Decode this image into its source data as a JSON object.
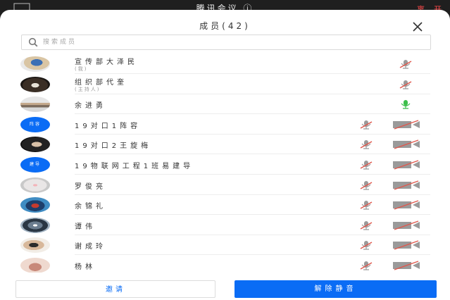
{
  "topbar": {
    "title": "腾讯会议 ⓘ",
    "leave": "离",
    "end": "开"
  },
  "panel": {
    "title": "成员(42)",
    "search_placeholder": "搜索成员"
  },
  "colors": {
    "accent": "#0a6cf5",
    "muted_red": "#e0574c",
    "mic_on_green": "#3bbf4a"
  },
  "members": [
    {
      "name": "宣传部大泽民",
      "subtitle": "(我)",
      "avatar": "photo",
      "mic": "muted",
      "cam": null
    },
    {
      "name": "组织部代奎",
      "subtitle": "(主持人)",
      "avatar": "photo",
      "mic": "muted",
      "cam": null
    },
    {
      "name": "余进勇",
      "subtitle": "",
      "avatar": "photo",
      "mic": "on",
      "cam": null
    },
    {
      "name": "19对口1阵容",
      "subtitle": "",
      "avatar": "badge",
      "badge_text": "阵容",
      "mic": "muted",
      "cam": "off"
    },
    {
      "name": "19对口2王旋梅",
      "subtitle": "",
      "avatar": "photo",
      "mic": "muted",
      "cam": "off"
    },
    {
      "name": "19物联网工程1班易建导",
      "subtitle": "",
      "avatar": "badge",
      "badge_text": "建导",
      "mic": "muted",
      "cam": "off"
    },
    {
      "name": "罗俊亮",
      "subtitle": "",
      "avatar": "photo",
      "mic": "muted",
      "cam": "off"
    },
    {
      "name": "余锦礼",
      "subtitle": "",
      "avatar": "photo",
      "mic": "muted",
      "cam": "off"
    },
    {
      "name": "谭伟",
      "subtitle": "",
      "avatar": "photo",
      "mic": "muted",
      "cam": "off"
    },
    {
      "name": "谢成玲",
      "subtitle": "",
      "avatar": "photo",
      "mic": "muted",
      "cam": "off"
    },
    {
      "name": "杨林",
      "subtitle": "",
      "avatar": "photo",
      "mic": "muted",
      "cam": "off"
    }
  ],
  "footer": {
    "invite_label": "邀请",
    "unmute_all_label": "解除静音"
  }
}
